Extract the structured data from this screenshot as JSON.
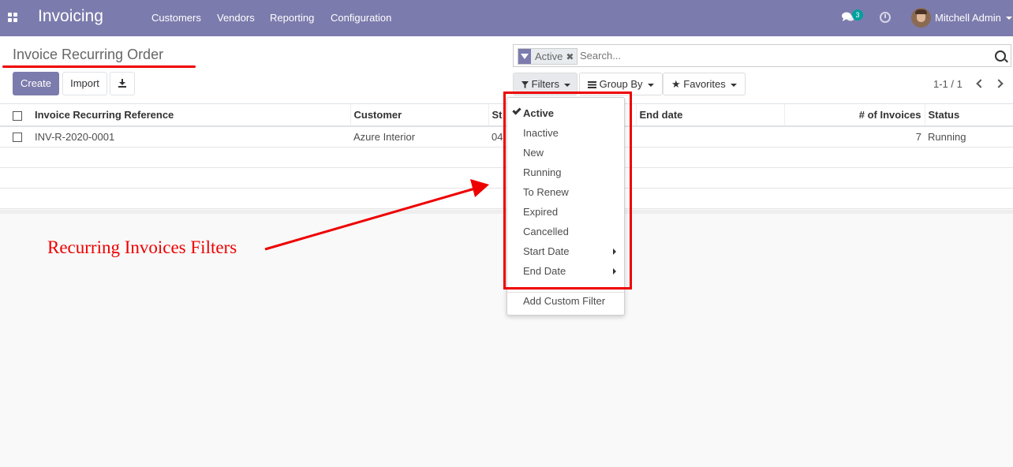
{
  "topbar": {
    "app_title": "Invoicing",
    "menu": [
      "Customers",
      "Vendors",
      "Reporting",
      "Configuration"
    ],
    "chat_badge": "3",
    "user_name": "Mitchell Admin",
    "bar_color": "#7c7bad"
  },
  "control_panel": {
    "title": "Invoice Recurring Order",
    "create_label": "Create",
    "import_label": "Import",
    "search": {
      "facet_label": "Active",
      "facet_remove": "✖",
      "placeholder": "Search..."
    },
    "filters_label": "Filters",
    "group_by_label": "Group By",
    "favorites_label": "Favorites",
    "pager": "1-1 / 1"
  },
  "list": {
    "headers": [
      "Invoice Recurring Reference",
      "Customer",
      "St",
      "End date",
      "# of Invoices",
      "Status"
    ],
    "rows": [
      {
        "reference": "INV-R-2020-0001",
        "customer": "Azure Interior",
        "start": "04",
        "end": "",
        "invoices": "7",
        "status": "Running"
      }
    ]
  },
  "filters_dropdown": {
    "items": [
      {
        "label": "Active",
        "checked": true
      },
      {
        "label": "Inactive"
      },
      {
        "label": "New"
      },
      {
        "label": "Running"
      },
      {
        "label": "To Renew"
      },
      {
        "label": "Expired"
      },
      {
        "label": "Cancelled"
      },
      {
        "label": "Start Date",
        "submenu": true
      },
      {
        "label": "End Date",
        "submenu": true
      }
    ],
    "custom_filter_label": "Add Custom Filter"
  },
  "annotation": {
    "text": "Recurring Invoices Filters",
    "color": "#e00000"
  }
}
